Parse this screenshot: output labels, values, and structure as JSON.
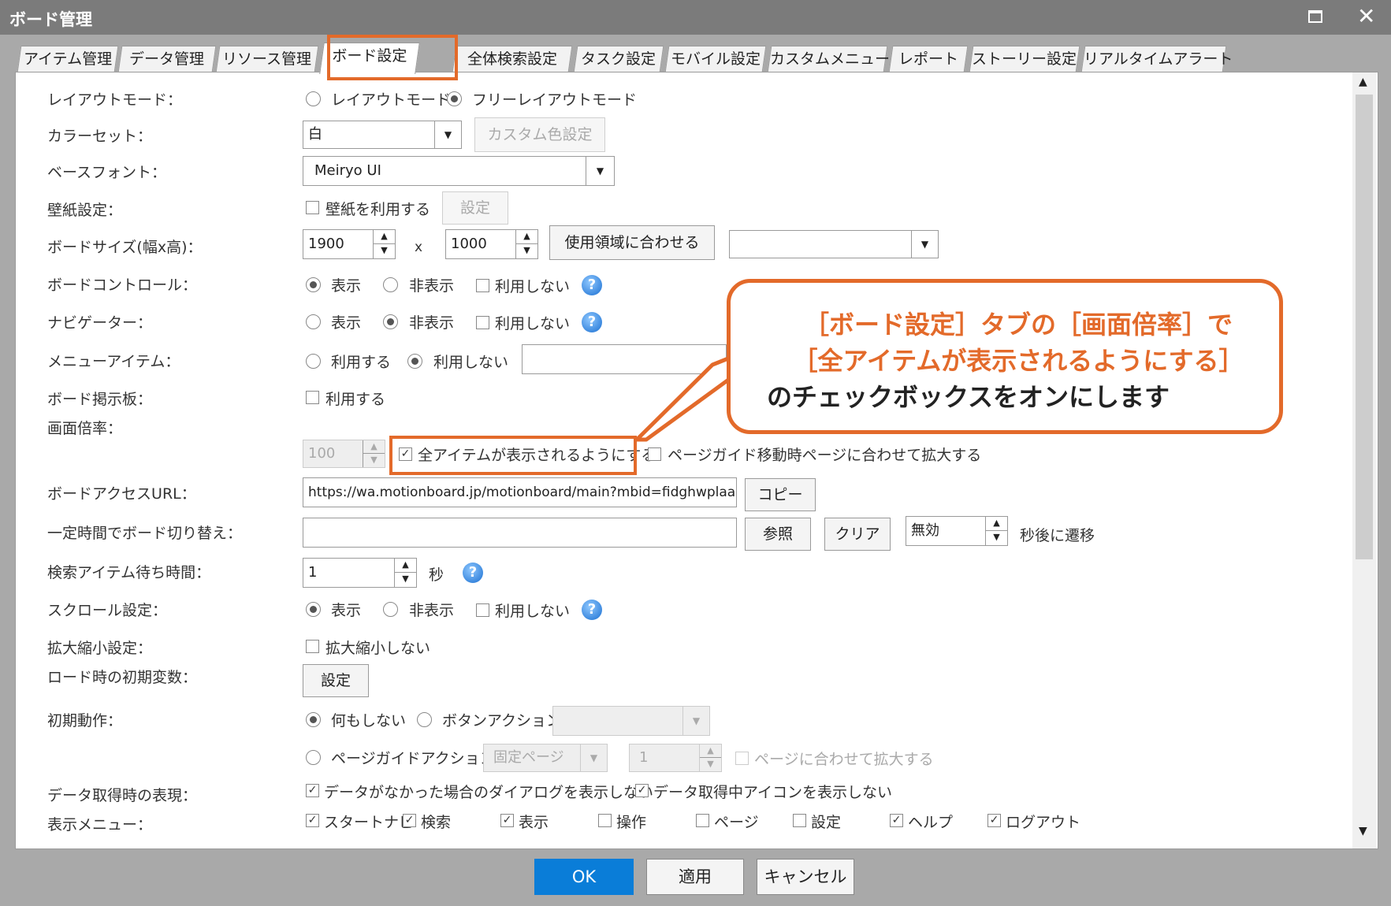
{
  "window": {
    "title": "ボード管理",
    "max_icon": "maximize-icon",
    "close_icon": "close-icon"
  },
  "tabs": [
    "アイテム管理",
    "データ管理",
    "リソース管理",
    "ボード設定",
    "全体検索設定",
    "タスク設定",
    "モバイル設定",
    "カスタムメニュー",
    "レポート",
    "ストーリー設定",
    "リアルタイムアラート"
  ],
  "active_tab": "ボード設定",
  "settings": {
    "layout": {
      "label": "レイアウトモード：",
      "opt1": "レイアウトモード",
      "opt2": "フリーレイアウトモード"
    },
    "colorset": {
      "label": "カラーセット：",
      "value": "白",
      "btn": "カスタム色設定"
    },
    "basefont": {
      "label": "ベースフォント：",
      "value": "Meiryo UI"
    },
    "wallpaper": {
      "label": "壁紙設定：",
      "check": "壁紙を利用する",
      "btn": "設定"
    },
    "boardsize": {
      "label": "ボードサイズ(幅x高)：",
      "w": "1900",
      "x": "x",
      "h": "1000",
      "btn": "使用領域に合わせる"
    },
    "boardcontrol": {
      "label": "ボードコントロール：",
      "opt1": "表示",
      "opt2": "非表示",
      "check": "利用しない"
    },
    "navigator": {
      "label": "ナビゲーター：",
      "opt1": "表示",
      "opt2": "非表示",
      "check": "利用しない"
    },
    "menuitem": {
      "label": "メニューアイテム：",
      "opt1": "利用する",
      "opt2": "利用しない"
    },
    "bulletin": {
      "label": "ボード掲示板：",
      "check": "利用する"
    },
    "zoom": {
      "label": "画面倍率：",
      "value": "100",
      "check1": "全アイテムが表示されるようにする",
      "check2": "ページガイド移動時ページに合わせて拡大する"
    },
    "accessurl": {
      "label": "ボードアクセスURL：",
      "value": "https://wa.motionboard.jp/motionboard/main?mbid=fidghwplaa",
      "btn": "コピー"
    },
    "switch": {
      "label": "一定時間でボード切り替え：",
      "btn1": "参照",
      "btn2": "クリア",
      "value": "無効",
      "suffix": "秒後に遷移"
    },
    "searchwait": {
      "label": "検索アイテム待ち時間：",
      "value": "1",
      "suffix": "秒"
    },
    "scroll": {
      "label": "スクロール設定：",
      "opt1": "表示",
      "opt2": "非表示",
      "check": "利用しない"
    },
    "zoomio": {
      "label": "拡大縮小設定：",
      "check": "拡大縮小しない"
    },
    "initvar": {
      "label": "ロード時の初期変数：",
      "btn": "設定"
    },
    "initaction": {
      "label": "初期動作：",
      "opt1": "何もしない",
      "opt2": "ボタンアクション",
      "opt3": "ページガイドアクション",
      "page": "固定ページ",
      "num": "1",
      "check": "ページに合わせて拡大する"
    },
    "fetch": {
      "label": "データ取得時の表現：",
      "check1": "データがなかった場合のダイアログを表示しない",
      "check2": "データ取得中アイコンを表示しない"
    },
    "menu": {
      "label": "表示メニュー：",
      "items": [
        "スタートナビ",
        "検索",
        "表示",
        "操作",
        "ページ",
        "設定",
        "ヘルプ",
        "ログアウト"
      ]
    }
  },
  "callout": {
    "line1": "［ボード設定］タブの［画面倍率］で",
    "line2": "［全アイテムが表示されるようにする］",
    "line3": "のチェックボックスをオンにします"
  },
  "footer": {
    "ok": "OK",
    "apply": "適用",
    "cancel": "キャンセル"
  },
  "accent": "#e36a2a",
  "primary": "#0a7dd8"
}
